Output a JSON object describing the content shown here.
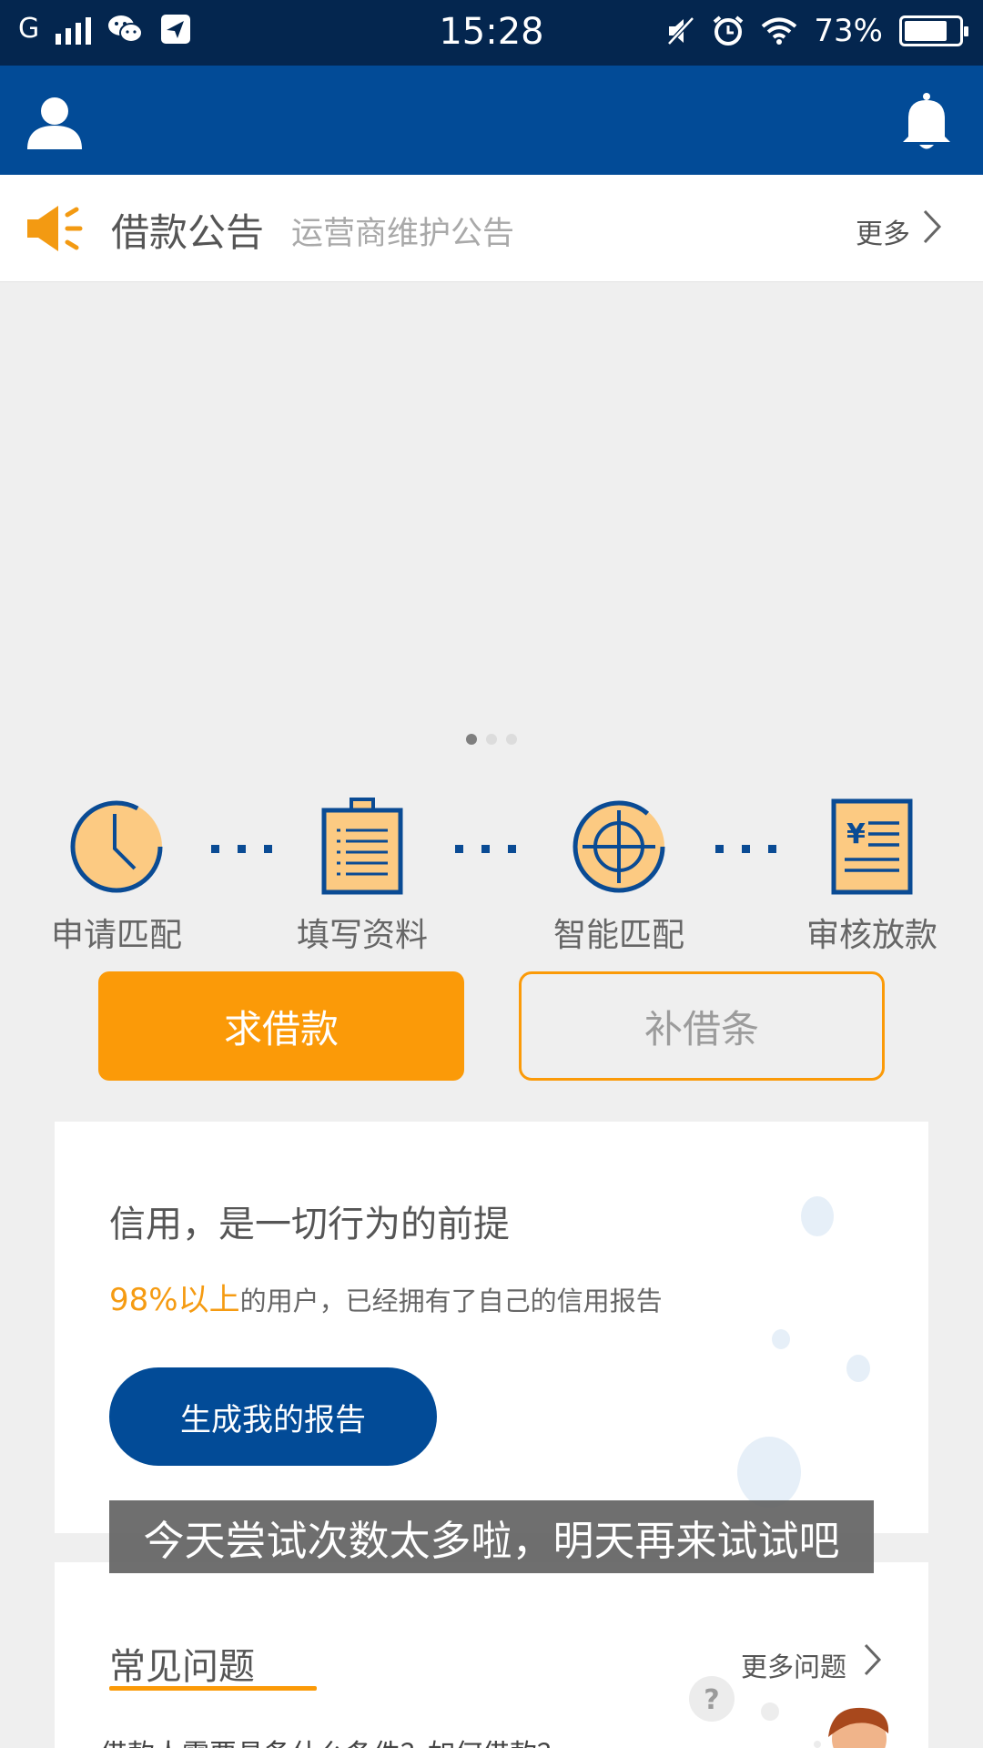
{
  "status_bar": {
    "network": "G",
    "time": "15:28",
    "battery": "73%",
    "battery_level": 0.73,
    "icons": [
      "signal-icon",
      "wechat-icon",
      "send-icon",
      "mute-icon",
      "alarm-icon",
      "wifi-icon",
      "battery-icon"
    ]
  },
  "app_bar": {
    "icons": [
      "user-icon",
      "bell-icon"
    ]
  },
  "notice": {
    "title": "借款公告",
    "text": "运营商维护公告",
    "more": "更多"
  },
  "banner": {
    "page_count": 3,
    "active_page": 1
  },
  "steps": [
    {
      "label": "申请匹配",
      "icon": "clock-icon"
    },
    {
      "label": "填写资料",
      "icon": "clipboard-icon"
    },
    {
      "label": "智能匹配",
      "icon": "target-icon"
    },
    {
      "label": "审核放款",
      "icon": "invoice-icon"
    }
  ],
  "actions": {
    "borrow": "求借款",
    "iou": "补借条"
  },
  "credit": {
    "title": "信用，是一切行为的前提",
    "highlight": "98%以上",
    "rest": "的用户，已经拥有了自己的信用报告",
    "button": "生成我的报告"
  },
  "toast": "今天尝试次数太多啦，明天再来试试吧",
  "faq": {
    "title": "常见问题",
    "more": "更多问题",
    "first_question": "借款人需要具备什么条件？如何借款？"
  },
  "colors": {
    "status_bar": "#04264f",
    "app_bar": "#024b97",
    "accent": "#fb9a08",
    "icon_fill": "#fcca82"
  }
}
